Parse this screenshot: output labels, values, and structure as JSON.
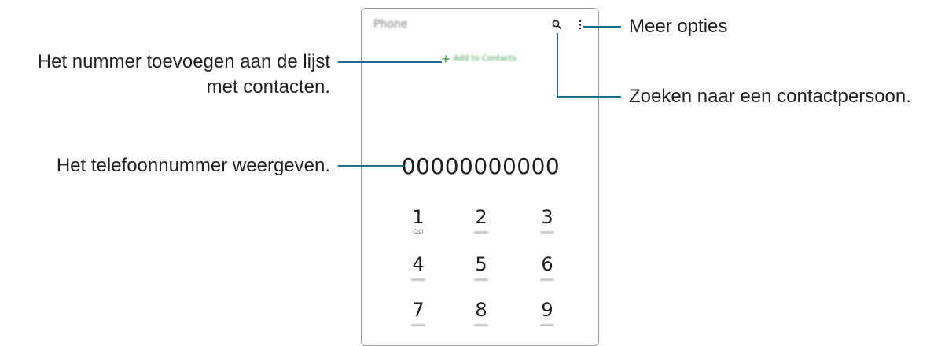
{
  "phone": {
    "app_title": "Phone",
    "add_contacts_label": "Add to Contacts",
    "number": "00000000000",
    "accent_color": "#3f9b4f",
    "keys": [
      {
        "digit": "1"
      },
      {
        "digit": "2"
      },
      {
        "digit": "3"
      },
      {
        "digit": "4"
      },
      {
        "digit": "5"
      },
      {
        "digit": "6"
      },
      {
        "digit": "7"
      },
      {
        "digit": "8"
      },
      {
        "digit": "9"
      }
    ],
    "icons": [
      "search-icon",
      "more-options-icon",
      "plus-icon",
      "voicemail-icon"
    ]
  },
  "callouts": {
    "more_options": "Meer opties",
    "search_contact": "Zoeken naar een contactpersoon.",
    "add_to_list_line1": "Het nummer toevoegen aan de lijst",
    "add_to_list_line2": "met contacten.",
    "show_number": "Het telefoonnummer weergeven."
  },
  "leader_color": "#1a6e94"
}
